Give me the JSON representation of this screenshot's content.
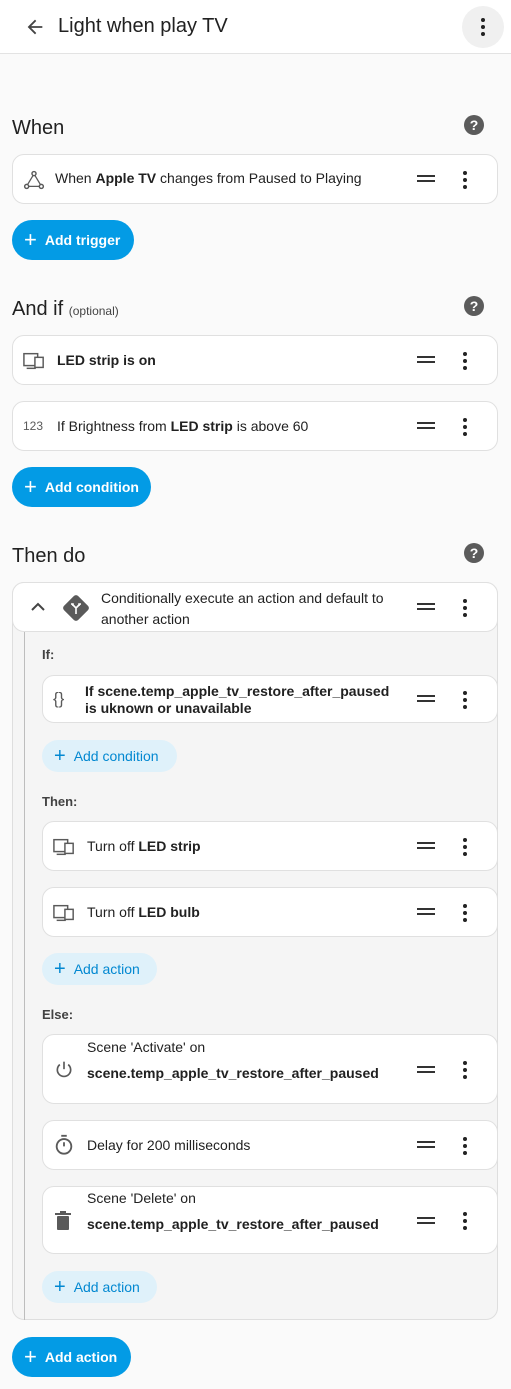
{
  "header": {
    "title": "Light when play TV"
  },
  "when": {
    "title": "When",
    "trigger": {
      "prefix": "When ",
      "entity": "Apple TV",
      "suffix": " changes from Paused to Playing"
    },
    "add_label": "Add trigger"
  },
  "and_if": {
    "title": "And if",
    "optional": "(optional)",
    "cond1": {
      "entity": "LED strip",
      "suffix": " is on"
    },
    "cond2": {
      "prefix": "If Brightness from ",
      "entity": "LED strip",
      "suffix": " is above 60"
    },
    "numeric_icon": "123",
    "add_label": "Add condition"
  },
  "then_do": {
    "title": "Then do",
    "choose": {
      "line1": "Conditionally execute an action and default to",
      "line2": "another action"
    },
    "if_label": "If:",
    "template_cond": {
      "line1": "If scene.temp_apple_tv_restore_after_paused",
      "line2": "is uknown or unavailable"
    },
    "template_icon": "{}",
    "add_condition_label": "Add condition",
    "then_label": "Then:",
    "action1": {
      "prefix": "Turn off ",
      "entity": "LED strip"
    },
    "action2": {
      "prefix": "Turn off ",
      "entity": "LED bulb"
    },
    "add_action_label": "Add action",
    "else_label": "Else:",
    "else1": {
      "line1": "Scene 'Activate' on",
      "line2": "scene.temp_apple_tv_restore_after_paused"
    },
    "else2": {
      "text": "Delay for 200 milliseconds"
    },
    "else3": {
      "line1": "Scene 'Delete' on",
      "line2": "scene.temp_apple_tv_restore_after_paused"
    },
    "add_action_label2": "Add action",
    "main_add_action_label": "Add action"
  },
  "help_glyph": "?",
  "icons": [
    "back-arrow-icon",
    "kebab-icon",
    "help-icon",
    "trigger-state-icon",
    "device-icon",
    "numeric-icon",
    "chevron-up-icon",
    "choose-icon",
    "template-icon",
    "power-icon",
    "timer-icon",
    "trash-icon",
    "drag-handle-icon",
    "plus-icon"
  ],
  "colors": {
    "accent": "#039be5",
    "accent_light": "#dff1fa",
    "icon_gray": "#5a5a5a"
  }
}
